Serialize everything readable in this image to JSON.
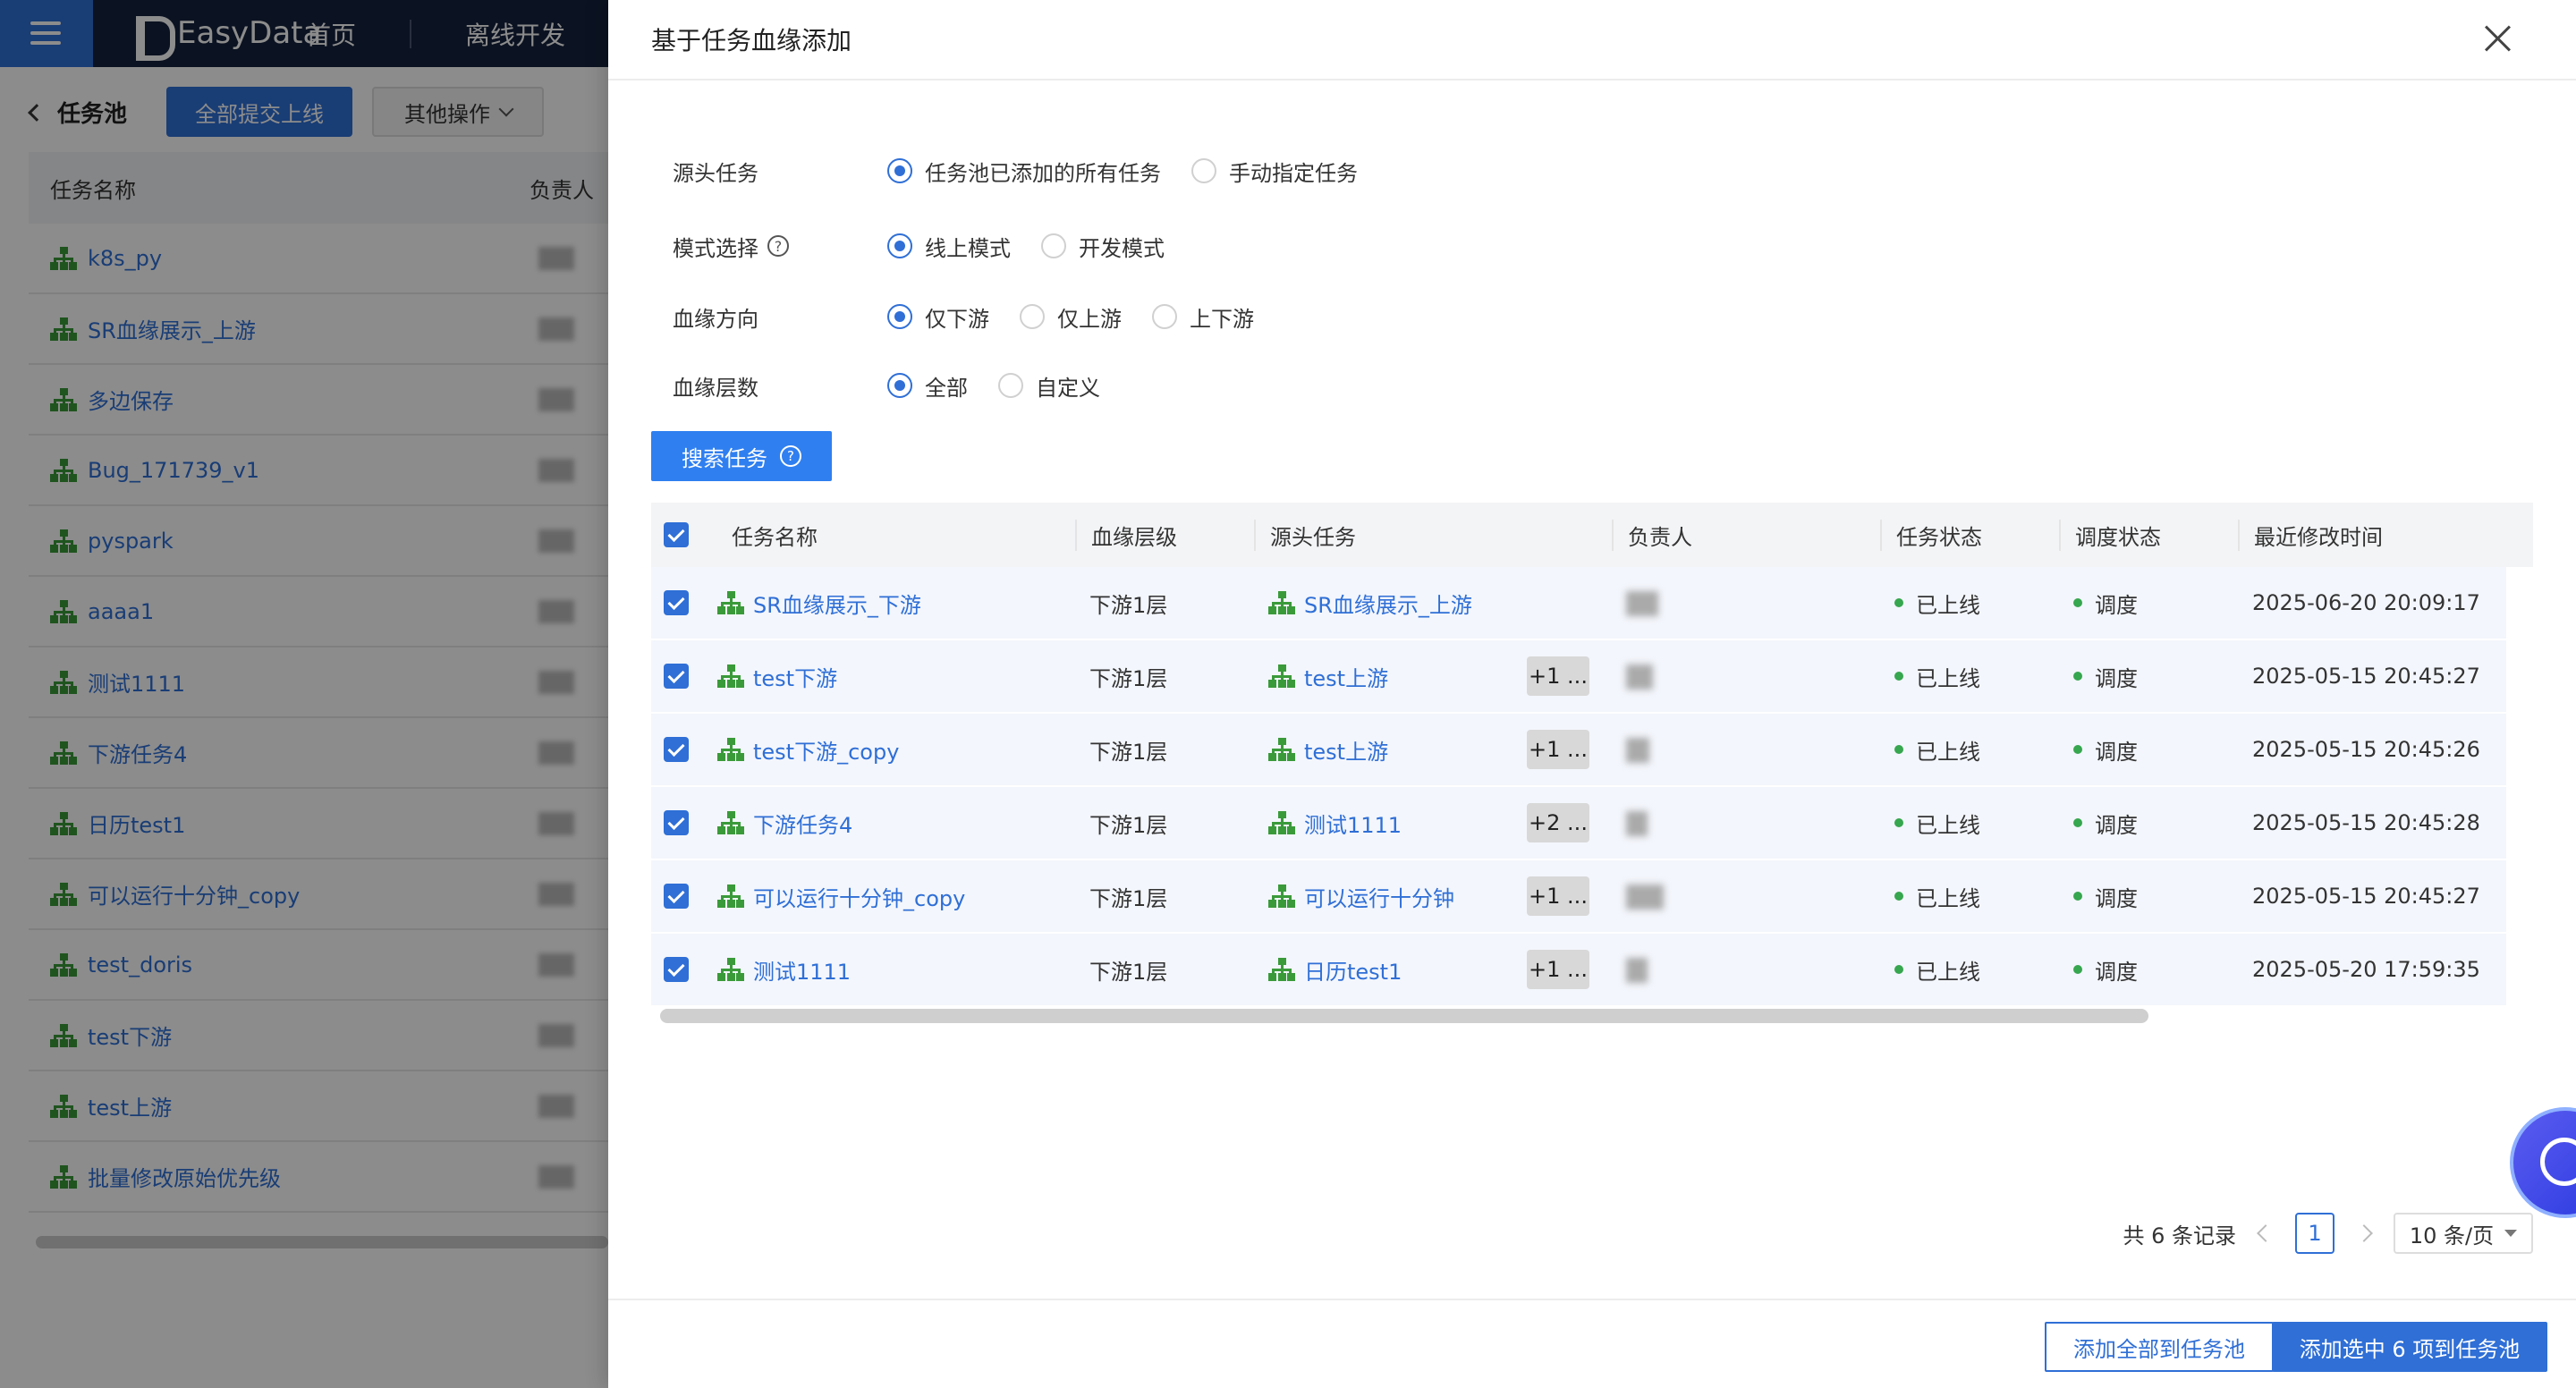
{
  "app": {
    "logo_text": "EasyData",
    "nav": [
      "首页",
      "离线开发"
    ]
  },
  "subbar": {
    "back_label": "任务池",
    "submit_label": "全部提交上线",
    "other_label": "其他操作"
  },
  "bg_table": {
    "headers": [
      "任务名称",
      "负责人"
    ],
    "rows": [
      "k8s_py",
      "SR血缘展示_上游",
      "多边保存",
      "Bug_171739_v1",
      "pyspark",
      "aaaa1",
      "测试1111",
      "下游任务4",
      "日历test1",
      "可以运行十分钟_copy",
      "test_doris",
      "test下游",
      "test上游",
      "批量修改原始优先级"
    ]
  },
  "drawer": {
    "title": "基于任务血缘添加",
    "source_task": {
      "label": "源头任务",
      "options": [
        "任务池已添加的所有任务",
        "手动指定任务"
      ],
      "selected": 0
    },
    "mode": {
      "label": "模式选择",
      "options": [
        "线上模式",
        "开发模式"
      ],
      "selected": 0
    },
    "direction": {
      "label": "血缘方向",
      "options": [
        "仅下游",
        "仅上游",
        "上下游"
      ],
      "selected": 0
    },
    "depth": {
      "label": "血缘层数",
      "options": [
        "全部",
        "自定义"
      ],
      "selected": 0
    },
    "search_label": "搜索任务",
    "table": {
      "headers": [
        "任务名称",
        "血缘层级",
        "源头任务",
        "负责人",
        "任务状态",
        "调度状态",
        "最近修改时间"
      ],
      "rows": [
        {
          "name": "SR血缘展示_下游",
          "level": "下游1层",
          "source": "SR血缘展示_上游",
          "more": "",
          "task_status": "已上线",
          "sched_status": "调度",
          "time": "2025-06-20 20:09:17"
        },
        {
          "name": "test下游",
          "level": "下游1层",
          "source": "test上游",
          "more": "+1 ...",
          "task_status": "已上线",
          "sched_status": "调度",
          "time": "2025-05-15 20:45:27"
        },
        {
          "name": "test下游_copy",
          "level": "下游1层",
          "source": "test上游",
          "more": "+1 ...",
          "task_status": "已上线",
          "sched_status": "调度",
          "time": "2025-05-15 20:45:26"
        },
        {
          "name": "下游任务4",
          "level": "下游1层",
          "source": "测试1111",
          "more": "+2 ...",
          "task_status": "已上线",
          "sched_status": "调度",
          "time": "2025-05-15 20:45:28"
        },
        {
          "name": "可以运行十分钟_copy",
          "level": "下游1层",
          "source": "可以运行十分钟",
          "more": "+1 ...",
          "task_status": "已上线",
          "sched_status": "调度",
          "time": "2025-05-15 20:45:27"
        },
        {
          "name": "测试1111",
          "level": "下游1层",
          "source": "日历test1",
          "more": "+1 ...",
          "task_status": "已上线",
          "sched_status": "调度",
          "time": "2025-05-20 17:59:35"
        }
      ]
    },
    "pager": {
      "total": "共 6 条记录",
      "page": "1",
      "page_size": "10 条/页"
    },
    "footer": {
      "add_all": "添加全部到任务池",
      "add_selected": "添加选中 6 项到任务池"
    }
  },
  "colors": {
    "primary": "#2f6fd6",
    "topbar": "#14213d",
    "online_dot": "#36a64f",
    "tree_icon": "#3a9a3a"
  }
}
